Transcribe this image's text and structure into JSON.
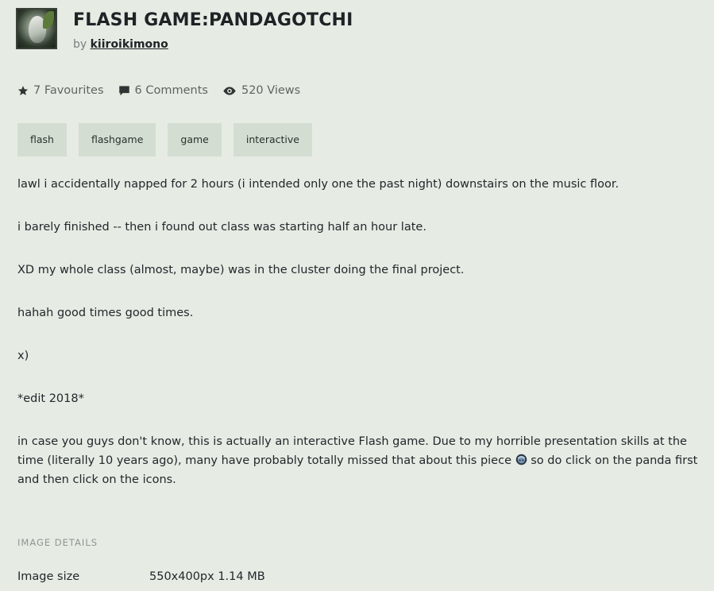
{
  "deviation": {
    "title": "FLASH GAME:PANDAGOTCHI",
    "by_label": "by",
    "author": "kiiroikimono"
  },
  "stats": {
    "favourites": "7 Favourites",
    "comments": "6 Comments",
    "views": "520 Views",
    "icons": [
      "star-icon",
      "comment-icon",
      "eye-icon"
    ]
  },
  "tags": [
    "flash",
    "flashgame",
    "game",
    "interactive"
  ],
  "description": {
    "p1": "lawl i accidentally napped for 2 hours (i intended only one the past night) downstairs on the music floor.",
    "p2": "i barely finished -- then i found out class was starting half an hour late.",
    "p3": "XD my whole class (almost, maybe) was in the cluster doing the final project.",
    "p4": "hahah good times good times.",
    "p5": "x)",
    "p6": "*edit 2018*",
    "p7a": "in case you guys don't know, this is actually an interactive Flash game. Due to my horrible presentation skills at the time (literally 10 years ago), many have probably totally missed that about this piece ",
    "p7b": " so do click on the panda first and then click on the icons."
  },
  "details": {
    "heading": "IMAGE DETAILS",
    "image_size_label": "Image size",
    "image_size_value": "550x400px 1.14 MB"
  },
  "colors": {
    "background": "#e6ebe4",
    "tag_background": "#d4ddd2",
    "text": "#22272b"
  }
}
